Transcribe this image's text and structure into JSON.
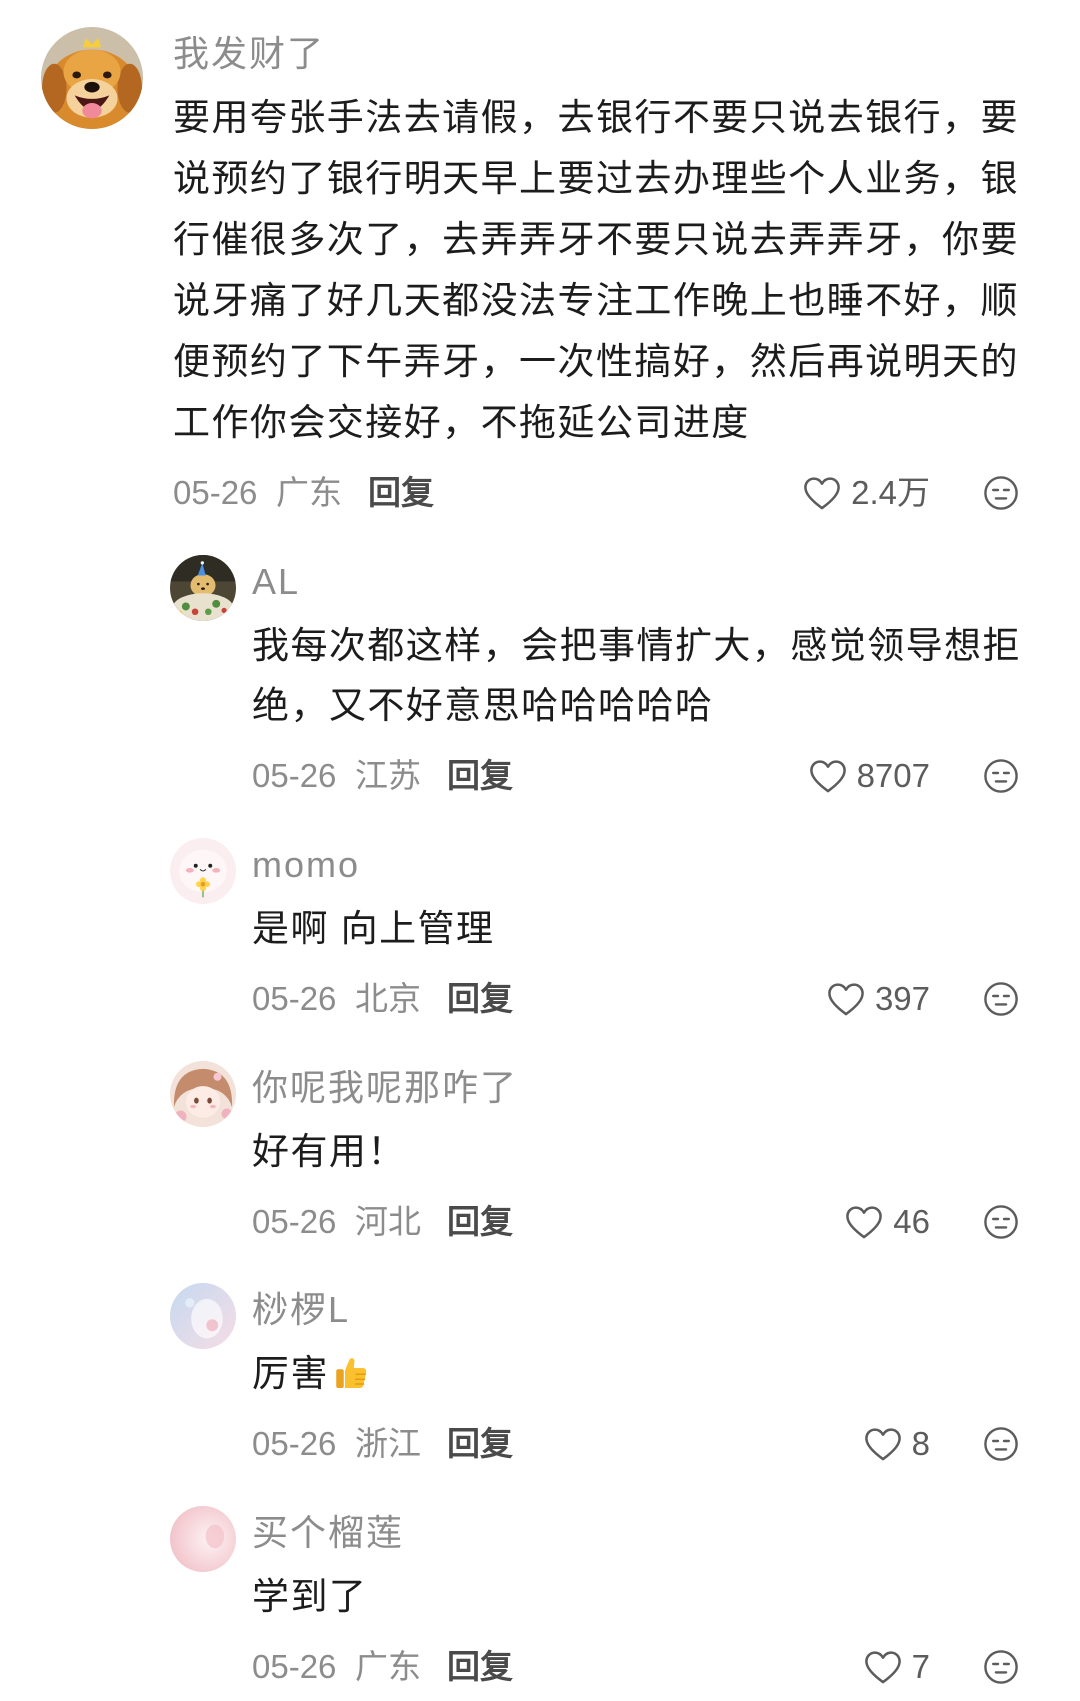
{
  "colors": {
    "background": "#ffffff",
    "username": "#8c8c8c",
    "text": "#1c1c1c",
    "meta": "#8c8c8c",
    "reply": "#4a4a4a",
    "count": "#5c5c5c",
    "icon": "#5c5c5c"
  },
  "icons": {
    "like": "heart-icon",
    "dislike": "dislike-icon"
  },
  "labels": {
    "reply": "回复"
  },
  "comments": {
    "main": {
      "username": "我发财了",
      "text": "要用夸张手法去请假，去银行不要只说去银行，要说预约了银行明天早上要过去办理些个人业务，银行催很多次了，去弄弄牙不要只说去弄弄牙，你要说牙痛了好几天都没法专注工作晚上也睡不好，顺便预约了下午弄牙，一次性搞好，然后再说明天的工作你会交接好，不拖延公司进度",
      "date": "05-26",
      "location": "广东",
      "likes": "2.4万"
    },
    "replies": [
      {
        "username": "AL",
        "text": "我每次都这样，会把事情扩大，感觉领导想拒绝，又不好意思哈哈哈哈哈",
        "date": "05-26",
        "location": "江苏",
        "likes": "8707"
      },
      {
        "username": "momo",
        "text": "是啊 向上管理",
        "date": "05-26",
        "location": "北京",
        "likes": "397"
      },
      {
        "username": "你呢我呢那咋了",
        "text": "好有用！",
        "date": "05-26",
        "location": "河北",
        "likes": "46"
      },
      {
        "username": "桫椤L",
        "text": "厉害",
        "emoji_icon": "thumbs-up-icon",
        "date": "05-26",
        "location": "浙江",
        "likes": "8"
      },
      {
        "username": "买个榴莲",
        "text": "学到了",
        "date": "05-26",
        "location": "广东",
        "likes": "7"
      }
    ]
  }
}
